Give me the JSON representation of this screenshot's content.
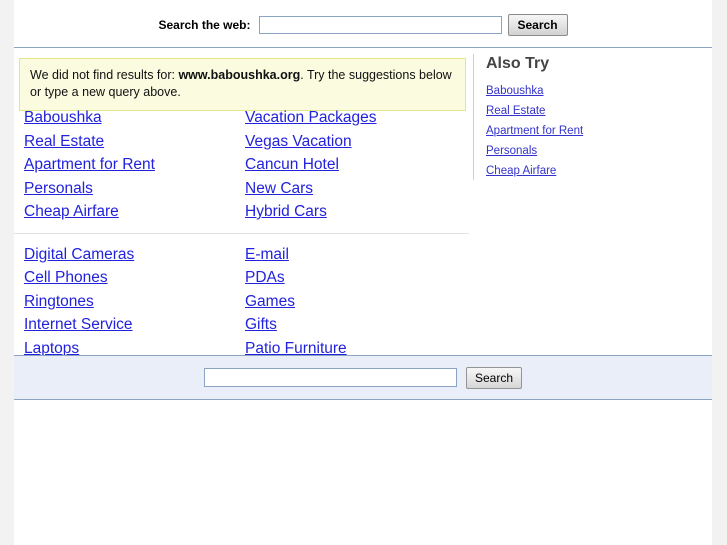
{
  "header": {
    "search_label": "Search the web:",
    "search_input_value": "",
    "search_input_placeholder": "",
    "search_button_label": "Search"
  },
  "message": {
    "prefix": "We did not find results for: ",
    "query": "www.baboushka.org",
    "suffix": ". Try the suggestions below or type a new query above."
  },
  "suggestions": {
    "groups": [
      {
        "left": [
          {
            "label": "Baboushka"
          },
          {
            "label": "Real Estate"
          },
          {
            "label": "Apartment for Rent"
          },
          {
            "label": "Personals"
          },
          {
            "label": "Cheap Airfare"
          }
        ],
        "right": [
          {
            "label": "Vacation Packages"
          },
          {
            "label": "Vegas Vacation"
          },
          {
            "label": "Cancun Hotel"
          },
          {
            "label": "New Cars"
          },
          {
            "label": "Hybrid Cars"
          }
        ]
      },
      {
        "left": [
          {
            "label": "Digital Cameras"
          },
          {
            "label": "Cell Phones"
          },
          {
            "label": "Ringtones"
          },
          {
            "label": "Internet Service"
          },
          {
            "label": "Laptops"
          }
        ],
        "right": [
          {
            "label": "E-mail"
          },
          {
            "label": "PDAs"
          },
          {
            "label": "Games"
          },
          {
            "label": "Gifts"
          },
          {
            "label": "Patio Furniture"
          }
        ]
      }
    ]
  },
  "also_try": {
    "title": "Also Try",
    "items": [
      {
        "label": "Baboushka"
      },
      {
        "label": "Real Estate"
      },
      {
        "label": "Apartment for Rent"
      },
      {
        "label": "Personals"
      },
      {
        "label": "Cheap Airfare"
      }
    ]
  },
  "footer": {
    "search_input_value": "",
    "search_input_placeholder": "",
    "search_button_label": "Search"
  },
  "colors": {
    "link": "#2222dd",
    "sidebar_link": "#3333cc",
    "message_bg": "#fbfbe0",
    "message_border": "#e5e58a",
    "rule": "#8ba4c4",
    "footer_bg": "#eaeef8",
    "page_bg": "#f2f2f2"
  }
}
